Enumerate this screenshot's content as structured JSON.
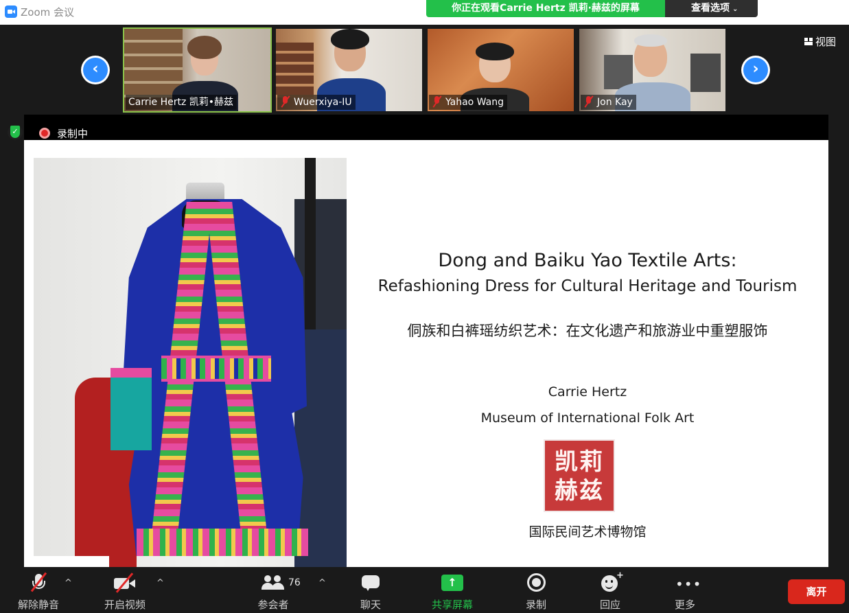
{
  "window": {
    "title": "Zoom 会议"
  },
  "banner": {
    "text": "你正在观看Carrie Hertz 凯莉·赫兹的屏幕",
    "options_label": "查看选项"
  },
  "gallery": {
    "view_label": "视图",
    "participants": [
      {
        "name": "Carrie Hertz 凯莉•赫兹",
        "muted": false,
        "active_speaker": true
      },
      {
        "name": "Wuerxiya-IU",
        "muted": true,
        "active_speaker": false
      },
      {
        "name": "Yahao Wang",
        "muted": true,
        "active_speaker": false
      },
      {
        "name": "Jon Kay",
        "muted": true,
        "active_speaker": false
      }
    ]
  },
  "recording": {
    "label": "录制中"
  },
  "slide": {
    "title_en_line1": "Dong and Baiku Yao Textile Arts:",
    "title_en_line2": "Refashioning Dress for Cultural Heritage and Tourism",
    "title_zh": "侗族和白裤瑶纺织艺术：在文化遗产和旅游业中重塑服饰",
    "author": "Carrie Hertz",
    "affiliation_en": "Museum of International Folk Art",
    "seal_chars": [
      "凯",
      "莉",
      "赫",
      "兹"
    ],
    "affiliation_zh": "国际民间艺术博物馆"
  },
  "toolbar": {
    "unmute": "解除静音",
    "start_video": "开启视频",
    "participants": "参会者",
    "participant_count": "76",
    "chat": "聊天",
    "share_screen": "共享屏幕",
    "record": "录制",
    "reactions": "回应",
    "more": "更多",
    "leave": "离开"
  },
  "colors": {
    "accent_blue": "#2d8cff",
    "share_green": "#23c04a",
    "leave_red": "#d9271c",
    "muted_red": "#e02828"
  }
}
